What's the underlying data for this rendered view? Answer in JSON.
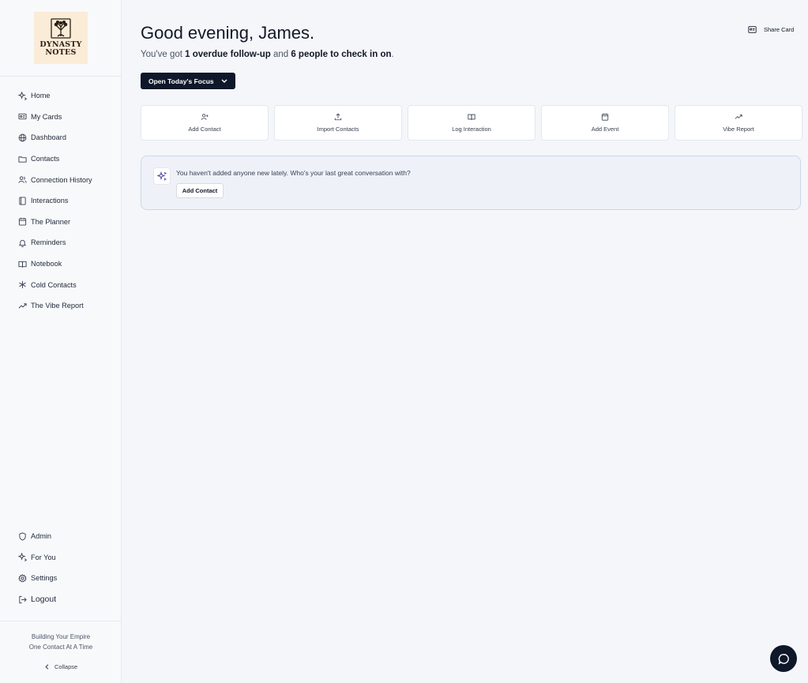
{
  "brand": {
    "logo_text_line1": "DYNASTY",
    "logo_text_line2": "NOTES"
  },
  "sidebar": {
    "items": [
      {
        "label": "Home",
        "icon": "sparkles-icon"
      },
      {
        "label": "My Cards",
        "icon": "id-card-icon"
      },
      {
        "label": "Dashboard",
        "icon": "globe-icon"
      },
      {
        "label": "Contacts",
        "icon": "folder-icon"
      },
      {
        "label": "Connection History",
        "icon": "users-icon"
      },
      {
        "label": "Interactions",
        "icon": "book-icon"
      },
      {
        "label": "The Planner",
        "icon": "calendar-icon"
      },
      {
        "label": "Reminders",
        "icon": "bell-icon"
      },
      {
        "label": "Notebook",
        "icon": "open-book-icon"
      },
      {
        "label": "Cold Contacts",
        "icon": "snowflake-icon"
      },
      {
        "label": "The Vibe Report",
        "icon": "trending-up-icon"
      }
    ],
    "bottom_items": [
      {
        "label": "Admin",
        "icon": "shield-icon"
      },
      {
        "label": "For You",
        "icon": "sparkles-icon"
      },
      {
        "label": "Settings",
        "icon": "gear-icon"
      },
      {
        "label": "Logout",
        "icon": "logout-icon"
      }
    ],
    "tagline_line1": "Building Your Empire",
    "tagline_line2": "One Contact At A Time",
    "collapse_label": "Collapse"
  },
  "header": {
    "greeting": "Good evening, James.",
    "sub_prefix": "You've got ",
    "overdue": "1 overdue follow-up",
    "sub_middle": " and ",
    "checkin": "6 people to check in on",
    "sub_suffix": ".",
    "share_label": "Share Card",
    "focus_button": "Open Today's Focus"
  },
  "quick_actions": [
    {
      "label": "Add Contact",
      "icon": "user-plus-icon"
    },
    {
      "label": "Import Contacts",
      "icon": "upload-icon"
    },
    {
      "label": "Log Interaction",
      "icon": "open-book-icon"
    },
    {
      "label": "Add Event",
      "icon": "calendar-icon"
    },
    {
      "label": "Vibe Report",
      "icon": "trending-up-icon"
    }
  ],
  "nudge": {
    "message": "You haven't added anyone new lately. Who's your last great conversation with?",
    "button": "Add Contact",
    "icon": "sparkles-icon"
  },
  "chat": {
    "icon": "chat-bubble-icon"
  },
  "colors": {
    "primary_dark": "#0f172a",
    "background": "#f4f6fa",
    "logo_bg": "#fbecd8",
    "nudge_accent": "#4f46a5"
  }
}
